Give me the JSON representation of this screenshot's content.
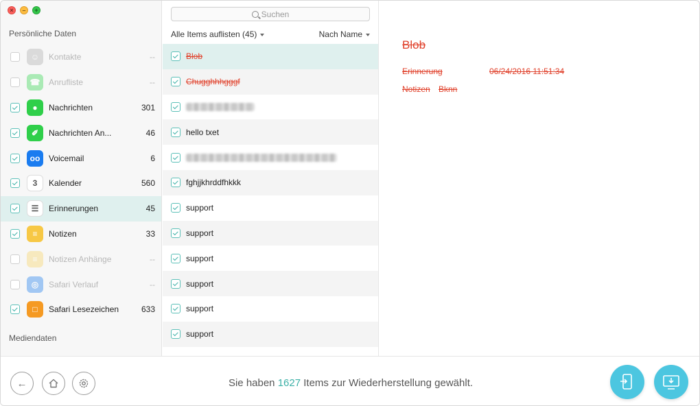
{
  "sidebar": {
    "section_personal": "Persönliche Daten",
    "section_media": "Mediendaten",
    "items": [
      {
        "label": "Kontakte",
        "count": "--",
        "checked": false,
        "disabled": true,
        "icon": "contacts-icon",
        "color": "#b8b8b8",
        "glyph": "☺"
      },
      {
        "label": "Anrufliste",
        "count": "--",
        "checked": false,
        "disabled": true,
        "icon": "phone-icon",
        "color": "#4cd964",
        "glyph": "☎"
      },
      {
        "label": "Nachrichten",
        "count": "301",
        "checked": true,
        "disabled": false,
        "icon": "messages-icon",
        "color": "#2fcf4a",
        "glyph": "●"
      },
      {
        "label": "Nachrichten An...",
        "count": "46",
        "checked": true,
        "disabled": false,
        "icon": "message-attachments-icon",
        "color": "#2fcf4a",
        "glyph": "✐"
      },
      {
        "label": "Voicemail",
        "count": "6",
        "checked": true,
        "disabled": false,
        "icon": "voicemail-icon",
        "color": "#1a7cf0",
        "glyph": "oo"
      },
      {
        "label": "Kalender",
        "count": "560",
        "checked": true,
        "disabled": false,
        "icon": "calendar-icon",
        "color": "#ffffff",
        "glyph": "3"
      },
      {
        "label": "Erinnerungen",
        "count": "45",
        "checked": true,
        "disabled": false,
        "icon": "reminders-icon",
        "color": "#ffffff",
        "glyph": "☰",
        "selected": true
      },
      {
        "label": "Notizen",
        "count": "33",
        "checked": true,
        "disabled": false,
        "icon": "notes-icon",
        "color": "#f7c845",
        "glyph": "≡"
      },
      {
        "label": "Notizen Anhänge",
        "count": "--",
        "checked": false,
        "disabled": true,
        "icon": "notes-attachments-icon",
        "color": "#f7d97a",
        "glyph": "≡"
      },
      {
        "label": "Safari Verlauf",
        "count": "--",
        "checked": false,
        "disabled": true,
        "icon": "safari-history-icon",
        "color": "#3a8ef0",
        "glyph": "◎"
      },
      {
        "label": "Safari Lesezeichen",
        "count": "633",
        "checked": true,
        "disabled": false,
        "icon": "bookmarks-icon",
        "color": "#f59a23",
        "glyph": "□"
      }
    ]
  },
  "middle": {
    "search_placeholder": "Suchen",
    "filter_label": "Alle Items auflisten (45)",
    "sort_label": "Nach Name",
    "rows": [
      {
        "text": "Blob",
        "deleted": true,
        "selected": true,
        "blurred": false
      },
      {
        "text": "Chugghhhgggf",
        "deleted": true,
        "selected": false,
        "blurred": false
      },
      {
        "text": "",
        "deleted": false,
        "selected": false,
        "blurred": true,
        "blur_width": 100
      },
      {
        "text": "hello txet",
        "deleted": false,
        "selected": false,
        "blurred": false
      },
      {
        "text": "",
        "deleted": false,
        "selected": false,
        "blurred": true,
        "blur_width": 220
      },
      {
        "text": "fghjjkhrddfhkkk",
        "deleted": false,
        "selected": false,
        "blurred": false
      },
      {
        "text": "support",
        "deleted": false,
        "selected": false,
        "blurred": false
      },
      {
        "text": "support",
        "deleted": false,
        "selected": false,
        "blurred": false
      },
      {
        "text": "support",
        "deleted": false,
        "selected": false,
        "blurred": false
      },
      {
        "text": "support",
        "deleted": false,
        "selected": false,
        "blurred": false
      },
      {
        "text": "support",
        "deleted": false,
        "selected": false,
        "blurred": false
      },
      {
        "text": "support",
        "deleted": false,
        "selected": false,
        "blurred": false
      }
    ]
  },
  "detail": {
    "title": "Blob",
    "reminder_label": "Erinnerung",
    "reminder_value": "06/24/2016 11:51:34",
    "notes_label": "Notizen",
    "notes_value": "Bknn"
  },
  "status": {
    "prefix": "Sie haben",
    "count": "1627",
    "suffix": "Items zur Wiederherstellung gewählt."
  },
  "colors": {
    "accent": "#3bb0a6",
    "deleted": "#e0402a",
    "action": "#4cc6e0"
  }
}
